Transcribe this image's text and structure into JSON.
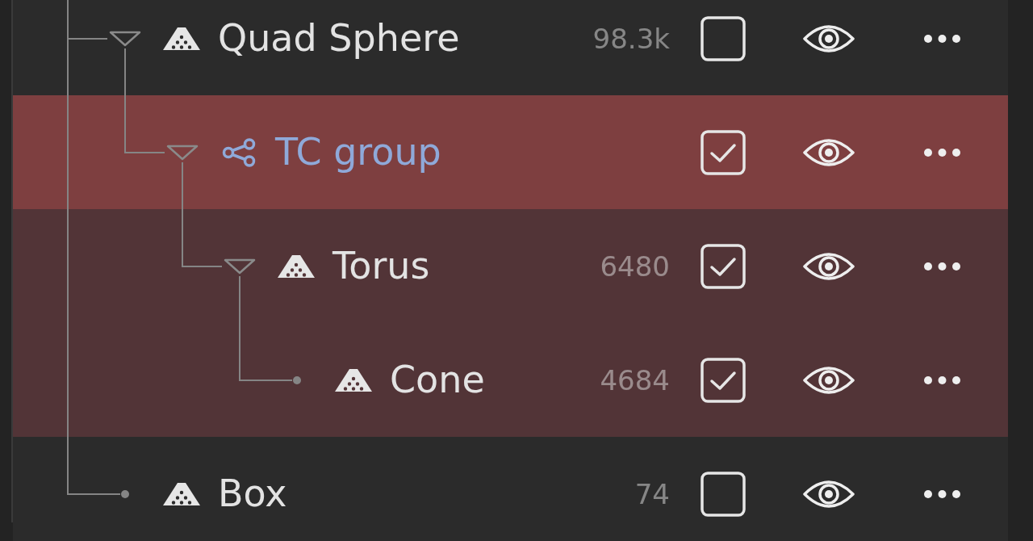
{
  "outliner": {
    "items": [
      {
        "name": "Quad Sphere",
        "kind": "mesh",
        "count": "98.3k",
        "checked": false,
        "visible": true,
        "selected": false,
        "expanded": true,
        "children": [
          {
            "name": "TC group",
            "kind": "group",
            "checked": true,
            "visible": true,
            "selected": true,
            "expanded": true,
            "children": [
              {
                "name": "Torus",
                "kind": "mesh",
                "count": "6480",
                "checked": true,
                "visible": true,
                "selected": false,
                "expanded": true,
                "children": [
                  {
                    "name": "Cone",
                    "kind": "mesh",
                    "count": "4684",
                    "checked": true,
                    "visible": true,
                    "selected": false
                  }
                ]
              }
            ]
          }
        ]
      },
      {
        "name": "Box",
        "kind": "mesh",
        "count": "74",
        "checked": false,
        "visible": true,
        "selected": false
      }
    ]
  }
}
